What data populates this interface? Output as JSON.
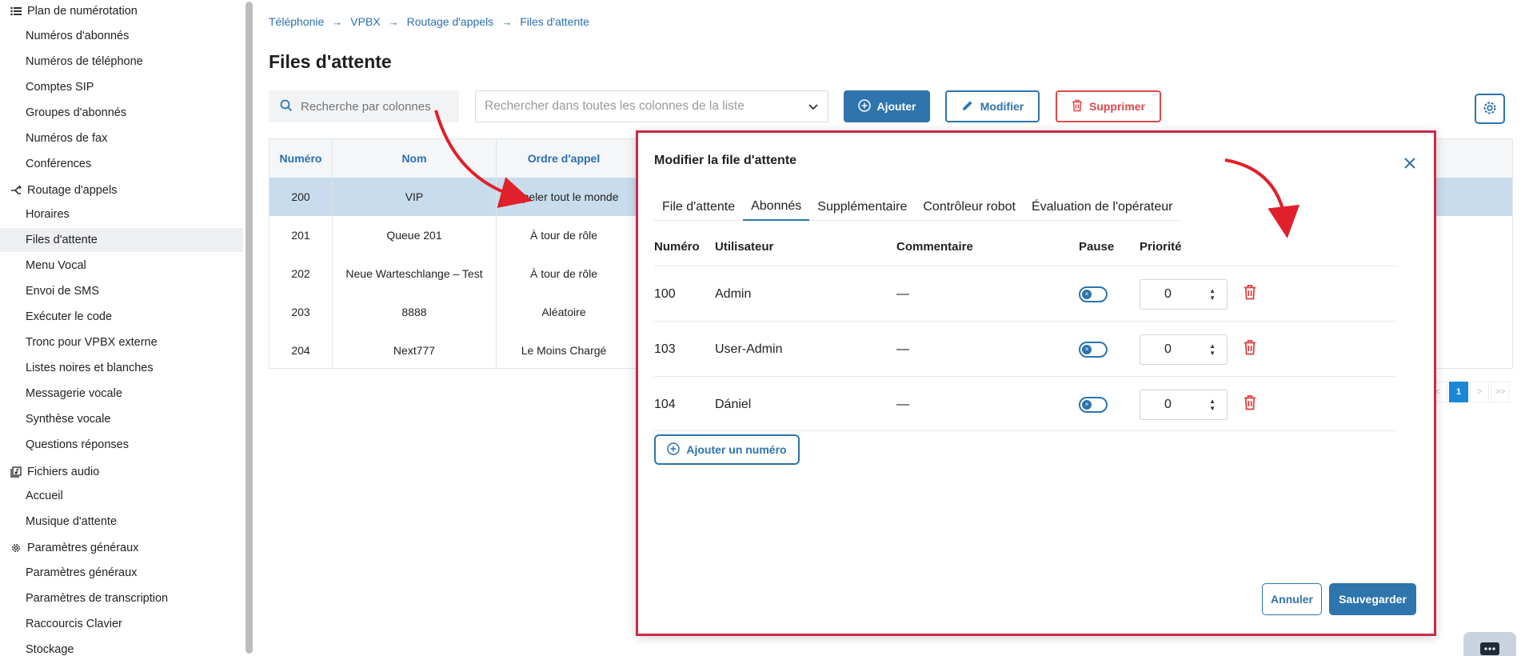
{
  "sidebar": {
    "groups": [
      {
        "label": "Plan de numérotation",
        "icon": "list-icon"
      },
      {
        "label": "Routage d'appels",
        "icon": "routing-icon"
      },
      {
        "label": "Fichiers audio",
        "icon": "audio-files-icon"
      },
      {
        "label": "Paramètres généraux",
        "icon": "gear-icon"
      }
    ],
    "items": [
      "Numéros d'abonnés",
      "Numéros de téléphone",
      "Comptes SIP",
      "Groupes d'abonnés",
      "Numéros de fax",
      "Conférences",
      "Horaires",
      "Files d'attente",
      "Menu Vocal",
      "Envoi de SMS",
      "Exécuter le code",
      "Tronc pour VPBX externe",
      "Listes noires et blanches",
      "Messagerie vocale",
      "Synthèse vocale",
      "Questions réponses",
      "Accueil",
      "Musique d'attente",
      "Paramètres généraux",
      "Paramètres de transcription",
      "Raccourcis Clavier",
      "Stockage"
    ],
    "active_item": "Files d'attente"
  },
  "breadcrumb": [
    "Téléphonie",
    "VPBX",
    "Routage d'appels",
    "Files d'attente"
  ],
  "page_title": "Files d'attente",
  "toolbar": {
    "search_columns_placeholder": "Recherche par colonnes",
    "search_all_placeholder": "Rechercher dans toutes les colonnes de la liste",
    "add_label": "Ajouter",
    "edit_label": "Modifier",
    "delete_label": "Supprimer"
  },
  "table": {
    "headers": [
      "Numéro",
      "Nom",
      "Ordre d'appel"
    ],
    "rows": [
      {
        "numero": "200",
        "nom": "VIP",
        "ordre": "Appeler tout le monde"
      },
      {
        "numero": "201",
        "nom": "Queue 201",
        "ordre": "À tour de rôle"
      },
      {
        "numero": "202",
        "nom": "Neue Warteschlange – Test",
        "ordre": "À tour de rôle"
      },
      {
        "numero": "203",
        "nom": "8888",
        "ordre": "Aléatoire"
      },
      {
        "numero": "204",
        "nom": "Next777",
        "ordre": "Le Moins Chargé"
      }
    ]
  },
  "pagination": {
    "prev": "<",
    "current": "1",
    "next": ">",
    "last": ">>"
  },
  "modal": {
    "title": "Modifier la file d'attente",
    "tabs": [
      "File d'attente",
      "Abonnés",
      "Supplémentaire",
      "Contrôleur robot",
      "Évaluation de l'opérateur"
    ],
    "active_tab": "Abonnés",
    "headers": [
      "Numéro",
      "Utilisateur",
      "Commentaire",
      "Pause",
      "Priorité"
    ],
    "rows": [
      {
        "numero": "100",
        "user": "Admin",
        "comment": "—",
        "priority": "0"
      },
      {
        "numero": "103",
        "user": "User-Admin",
        "comment": "—",
        "priority": "0"
      },
      {
        "numero": "104",
        "user": "Dániel",
        "comment": "—",
        "priority": "0"
      }
    ],
    "add_number_label": "Ajouter un numéro",
    "cancel_label": "Annuler",
    "save_label": "Sauvegarder"
  },
  "colors": {
    "primary": "#2e74ad",
    "danger": "#e04848",
    "annotation": "#cc2b45"
  }
}
